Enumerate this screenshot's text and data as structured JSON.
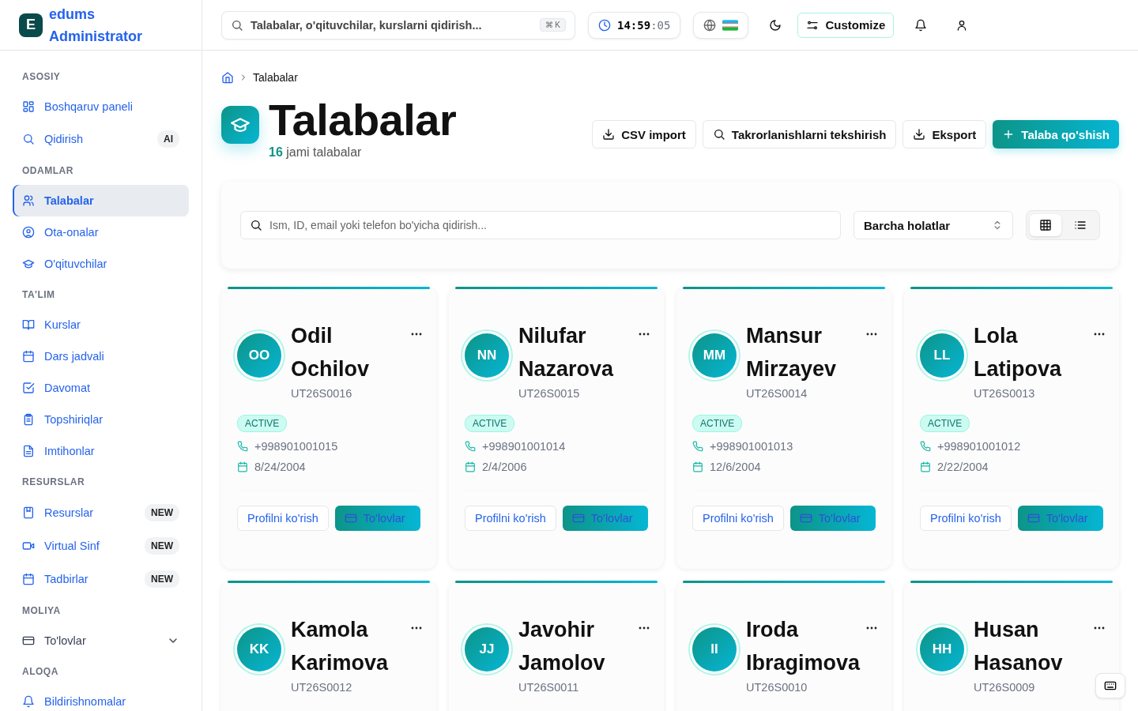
{
  "brand": {
    "logo_letter": "E",
    "name": "edums",
    "role": "Administrator"
  },
  "sidebar": {
    "sections": [
      {
        "label": "ASOSIY",
        "items": [
          {
            "label": "Boshqaruv paneli",
            "selected": false
          },
          {
            "label": "Qidirish",
            "selected": false,
            "badge": "AI"
          }
        ]
      },
      {
        "label": "ODAMLAR",
        "items": [
          {
            "label": "Talabalar",
            "selected": true
          },
          {
            "label": "Ota-onalar",
            "selected": false
          },
          {
            "label": "O'qituvchilar",
            "selected": false
          }
        ]
      },
      {
        "label": "TA'LIM",
        "items": [
          {
            "label": "Kurslar",
            "selected": false
          },
          {
            "label": "Dars jadvali",
            "selected": false
          },
          {
            "label": "Davomat",
            "selected": false
          },
          {
            "label": "Topshiriqlar",
            "selected": false
          },
          {
            "label": "Imtihonlar",
            "selected": false
          }
        ]
      },
      {
        "label": "RESURSLAR",
        "items": [
          {
            "label": "Resurslar",
            "selected": false,
            "badge": "NEW"
          },
          {
            "label": "Virtual Sinf",
            "selected": false,
            "badge": "NEW"
          },
          {
            "label": "Tadbirlar",
            "selected": false,
            "badge": "NEW"
          }
        ]
      },
      {
        "label": "MOLIYA",
        "items": [
          {
            "label": "To'lovlar",
            "selected": false,
            "kind": "group",
            "expanded": false
          }
        ]
      },
      {
        "label": "ALOQA",
        "items": [
          {
            "label": "Bildirishnomalar",
            "selected": false
          }
        ]
      }
    ]
  },
  "topbar": {
    "search": {
      "placeholder": "Talabalar, o'qituvchilar, kurslarni qidirish...",
      "shortcut": "⌘ K"
    },
    "clock": {
      "time": "14:59",
      "seconds": ":05"
    },
    "customize": "Customize"
  },
  "breadcrumb": {
    "current": "Talabalar"
  },
  "header": {
    "title": "Talabalar",
    "count": "16",
    "count_label": "jami talabalar",
    "buttons": [
      {
        "label": "CSV import",
        "kind": "import"
      },
      {
        "label": "Takrorlanishlarni tekshirish",
        "kind": "check"
      },
      {
        "label": "Eksport",
        "kind": "export"
      },
      {
        "label": "Talaba qo'shish",
        "kind": "primary"
      }
    ]
  },
  "filters": {
    "search": {
      "placeholder": "Ism, ID, email yoki telefon bo'yicha qidirish..."
    },
    "status": "Barcha holatlar",
    "views": [
      {
        "kind": "grid",
        "selected": true
      },
      {
        "kind": "list",
        "selected": false
      }
    ]
  },
  "students": [
    {
      "first": "Odil",
      "last": "Ochilov",
      "initials": "OO",
      "id": "UT26S0016",
      "status": "ACTIVE",
      "phone": "+998901001015",
      "birth": "8/24/2004",
      "actions": [
        "Profilni ko'rish",
        "To'lovlar"
      ]
    },
    {
      "first": "Nilufar",
      "last": "Nazarova",
      "initials": "NN",
      "id": "UT26S0015",
      "status": "ACTIVE",
      "phone": "+998901001014",
      "birth": "2/4/2006",
      "actions": [
        "Profilni ko'rish",
        "To'lovlar"
      ]
    },
    {
      "first": "Mansur",
      "last": "Mirzayev",
      "initials": "MM",
      "id": "UT26S0014",
      "status": "ACTIVE",
      "phone": "+998901001013",
      "birth": "12/6/2004",
      "actions": [
        "Profilni ko'rish",
        "To'lovlar"
      ]
    },
    {
      "first": "Lola",
      "last": "Latipova",
      "initials": "LL",
      "id": "UT26S0013",
      "status": "ACTIVE",
      "phone": "+998901001012",
      "birth": "2/22/2004",
      "actions": [
        "Profilni ko'rish",
        "To'lovlar"
      ]
    },
    {
      "first": "Kamola",
      "last": "Karimova",
      "initials": "KK",
      "id": "UT26S0012"
    },
    {
      "first": "Javohir",
      "last": "Jamolov",
      "initials": "JJ",
      "id": "UT26S0011"
    },
    {
      "first": "Iroda",
      "last": "Ibragimova",
      "initials": "II",
      "id": "UT26S0010"
    },
    {
      "first": "Husan",
      "last": "Hasanov",
      "initials": "HH",
      "id": "UT26S0009"
    }
  ]
}
